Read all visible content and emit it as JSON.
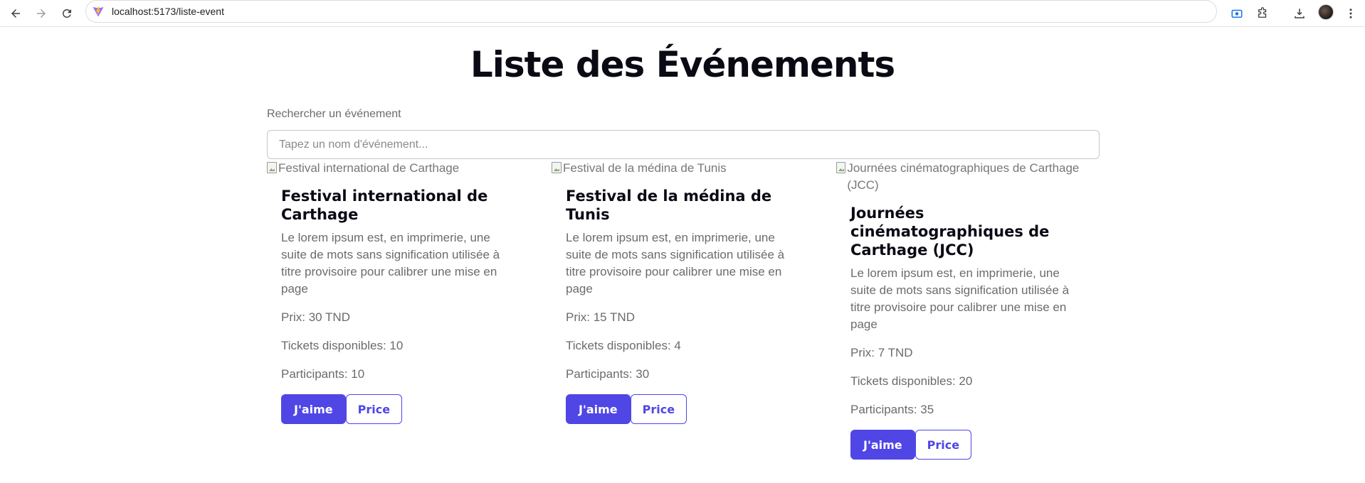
{
  "browser": {
    "url": "localhost:5173/liste-event"
  },
  "page": {
    "title": "Liste des Événements",
    "search_label": "Rechercher un événement",
    "search_placeholder": "Tapez un nom d'événement...",
    "search_value": ""
  },
  "events": [
    {
      "image_alt": "Festival international de Carthage",
      "title": "Festival international de Carthage",
      "description": "Le lorem ipsum est, en imprimerie, une suite de mots sans signification utilisée à titre provisoire pour calibrer une mise en page",
      "price": "Prix: 30 TND",
      "tickets": "Tickets disponibles: 10",
      "participants": "Participants: 10",
      "like_label": "J'aime",
      "price_label": "Price"
    },
    {
      "image_alt": "Festival de la médina de Tunis",
      "title": "Festival de la médina de Tunis",
      "description": "Le lorem ipsum est, en imprimerie, une suite de mots sans signification utilisée à titre provisoire pour calibrer une mise en page",
      "price": "Prix: 15 TND",
      "tickets": "Tickets disponibles: 4",
      "participants": "Participants: 30",
      "like_label": "J'aime",
      "price_label": "Price"
    },
    {
      "image_alt": "Journées cinématographiques de Carthage (JCC)",
      "title": "Journées cinématographiques de Carthage (JCC)",
      "description": "Le lorem ipsum est, en imprimerie, une suite de mots sans signification utilisée à titre provisoire pour calibrer une mise en page",
      "price": "Prix: 7 TND",
      "tickets": "Tickets disponibles: 20",
      "participants": "Participants: 35",
      "like_label": "J'aime",
      "price_label": "Price"
    }
  ],
  "colors": {
    "accent": "#4f46e5",
    "title": "#0a0a14",
    "muted_text": "#6b6b6b"
  }
}
